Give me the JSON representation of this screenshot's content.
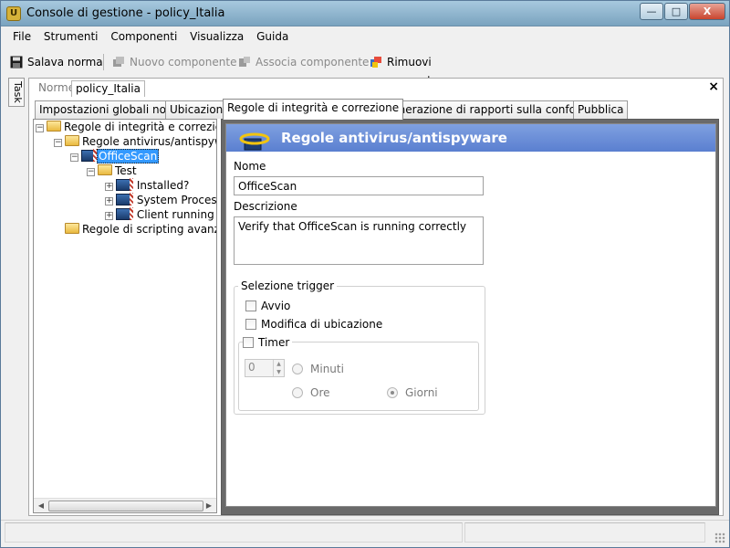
{
  "window": {
    "title": "Console di gestione  - policy_Italia",
    "app_icon_glyph": "U",
    "controls": {
      "minimize": "—",
      "maximize": "□",
      "close": "X"
    }
  },
  "menu": [
    "File",
    "Strumenti",
    "Componenti",
    "Visualizza",
    "Guida"
  ],
  "toolbar": {
    "save": "Salava norma",
    "new_component": "Nuovo componente",
    "associate_component": "Associa componente",
    "remove_component": "Rimuovi componente"
  },
  "side_task_tab": "Task",
  "doc_tabs": {
    "norme": "Norme",
    "policy": "policy_Italia",
    "close": "×"
  },
  "tabs": [
    "Impostazioni globali norme",
    "Ubicazioni",
    "Regole di integrità e correzione",
    "Generazione di rapporti sulla conformità",
    "Pubblica"
  ],
  "tree": {
    "root": "Regole di integrità e correzione",
    "antivirus": "Regole antivirus/antispywa",
    "officescan": "OfficeScan",
    "test": "Test",
    "installed": "Installed?",
    "system": "System Proces",
    "client": "Client running",
    "scripting": "Regole di scripting avanzat"
  },
  "form": {
    "header_title": "Regole antivirus/antispyware",
    "name_label": "Nome",
    "name_value": "OfficeScan",
    "desc_label": "Descrizione",
    "desc_value": "Verify that OfficeScan is running correctly",
    "trigger_group": "Selezione trigger",
    "avvio": "Avvio",
    "modifica": "Modifica di ubicazione",
    "timer": "Timer",
    "timer_value": "0",
    "minuti": "Minuti",
    "ore": "Ore",
    "giorni": "Giorni"
  },
  "colors": {
    "header_blue": "#6a8ed8",
    "selection": "#3399ff"
  }
}
